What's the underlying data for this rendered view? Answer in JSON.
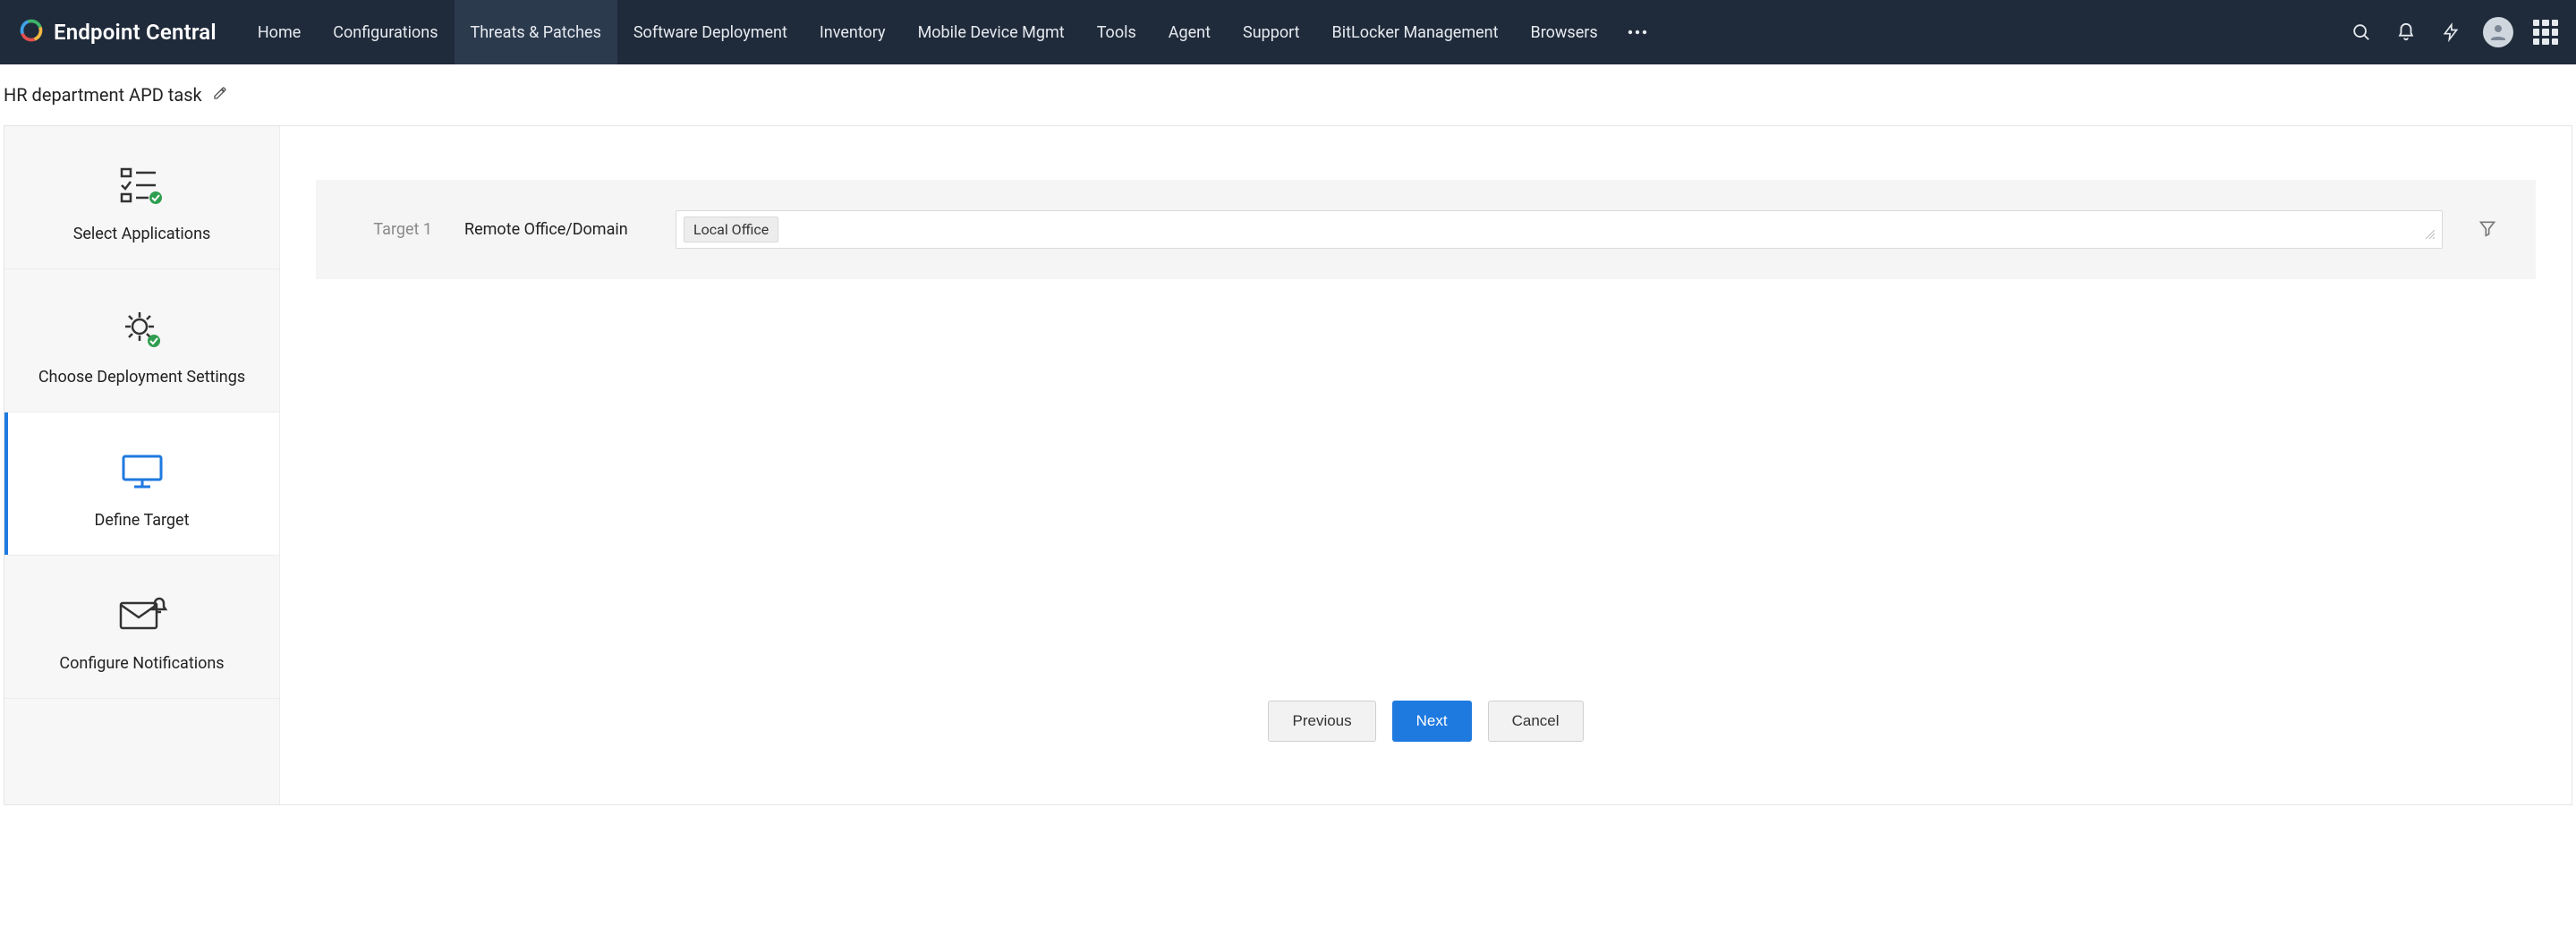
{
  "brand": {
    "name": "Endpoint Central"
  },
  "nav": {
    "items": [
      {
        "label": "Home",
        "active": false
      },
      {
        "label": "Configurations",
        "active": false
      },
      {
        "label": "Threats & Patches",
        "active": true
      },
      {
        "label": "Software Deployment",
        "active": false
      },
      {
        "label": "Inventory",
        "active": false
      },
      {
        "label": "Mobile Device Mgmt",
        "active": false
      },
      {
        "label": "Tools",
        "active": false
      },
      {
        "label": "Agent",
        "active": false
      },
      {
        "label": "Support",
        "active": false
      },
      {
        "label": "BitLocker Management",
        "active": false
      },
      {
        "label": "Browsers",
        "active": false
      }
    ]
  },
  "page": {
    "title": "HR department APD task"
  },
  "wizard": {
    "steps": [
      {
        "label": "Select Applications",
        "state": "done"
      },
      {
        "label": "Choose Deployment Settings",
        "state": "done"
      },
      {
        "label": "Define Target",
        "state": "active"
      },
      {
        "label": "Configure Notifications",
        "state": "pending"
      }
    ]
  },
  "target": {
    "index_label": "Target 1",
    "field_label": "Remote Office/Domain",
    "chips": [
      "Local Office"
    ],
    "input_placeholder": ""
  },
  "buttons": {
    "previous": "Previous",
    "next": "Next",
    "cancel": "Cancel"
  },
  "colors": {
    "accent": "#1f7ae0",
    "navbg": "#1f2a3a"
  }
}
